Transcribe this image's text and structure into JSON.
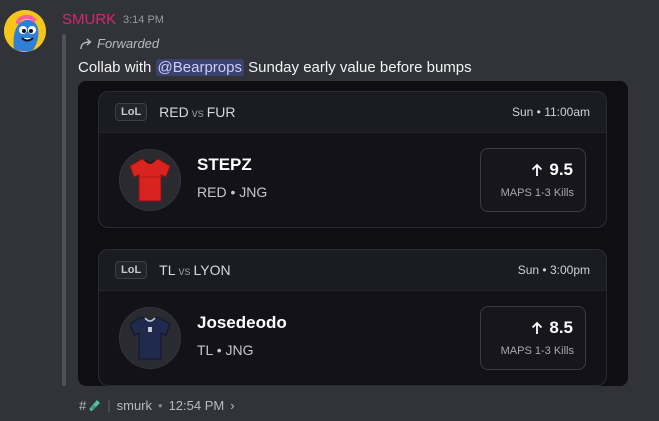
{
  "message": {
    "username": "SMURK",
    "timestamp": "3:14 PM",
    "forwarded_label": "Forwarded",
    "text_before": "Collab with ",
    "mention": "@Bearprops",
    "text_after": " Sunday early value before bumps",
    "colors": {
      "username": "#d6266e",
      "mention_bg": "#3c4270"
    }
  },
  "cards": [
    {
      "league": "LoL",
      "team1": "RED",
      "vs": "vs",
      "team2": "FUR",
      "time": "Sun • 11:00am",
      "player": "STEPZ",
      "team_role": "RED • JNG",
      "direction_icon": "arrow-up-icon",
      "line": "9.5",
      "stat_label": "MAPS 1-3 Kills",
      "jersey_color": "#d8231f"
    },
    {
      "league": "LoL",
      "team1": "TL",
      "vs": "vs",
      "team2": "LYON",
      "time": "Sun • 3:00pm",
      "player": "Josedeodo",
      "team_role": "TL • JNG",
      "direction_icon": "arrow-up-icon",
      "line": "8.5",
      "stat_label": "MAPS 1-3 Kills",
      "jersey_color": "#1f2a4d"
    }
  ],
  "footer": {
    "channel_hash": "#",
    "channel_icon": "test-tube-icon",
    "source": "smurk",
    "time": "12:54 PM",
    "chevron": "›"
  }
}
